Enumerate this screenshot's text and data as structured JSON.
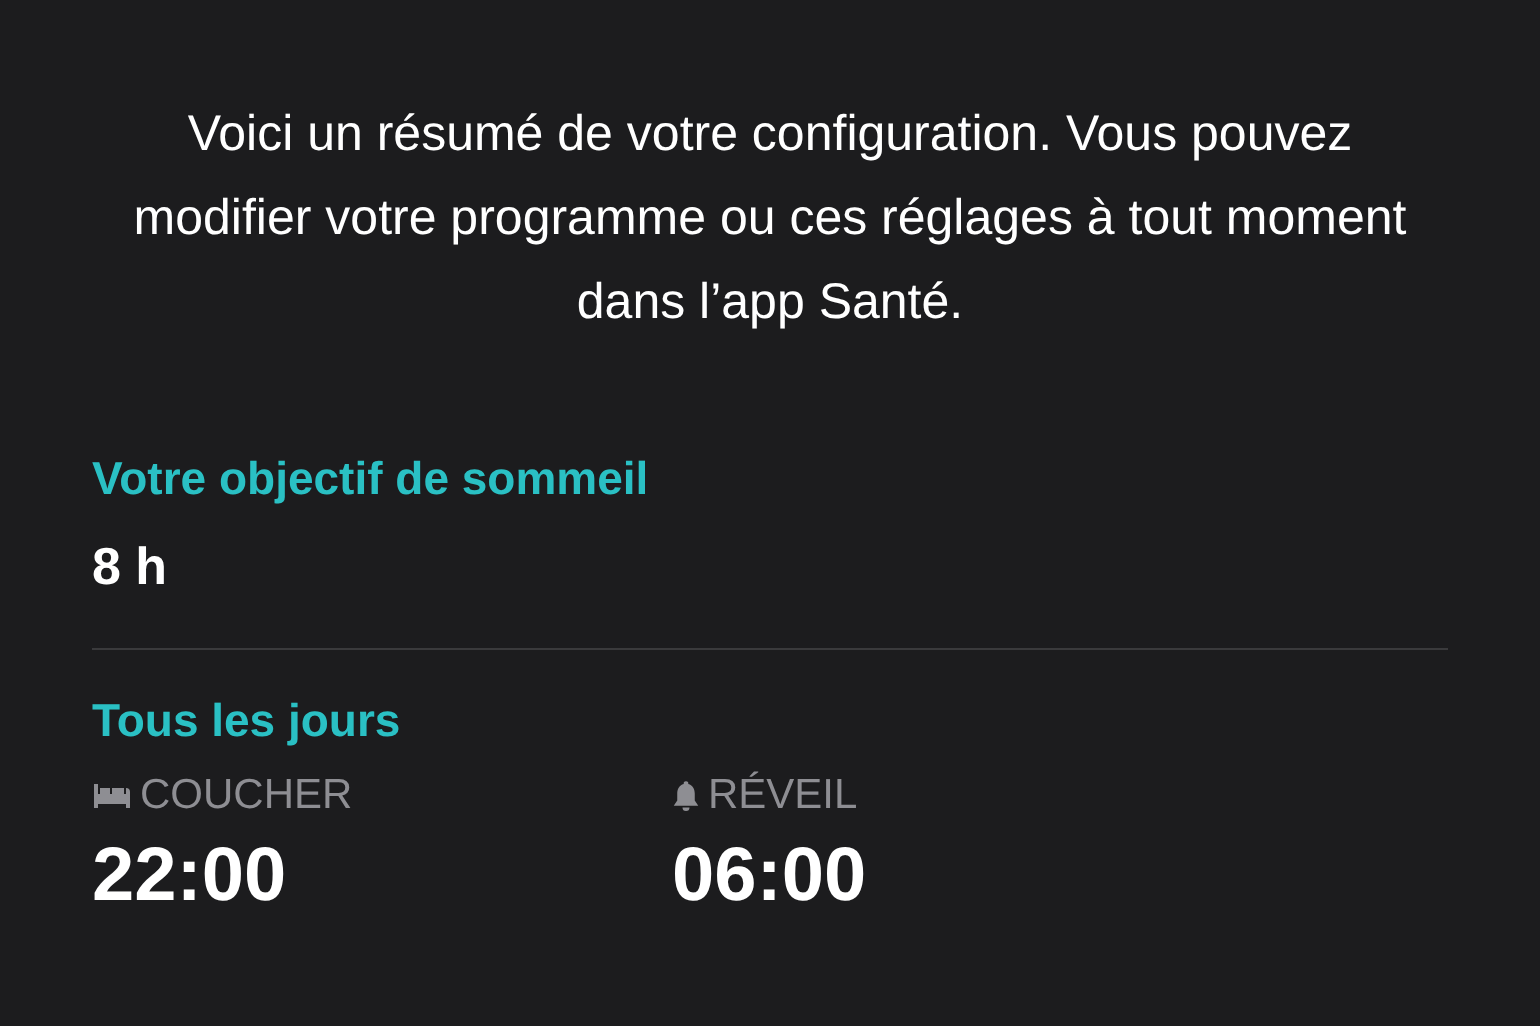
{
  "description": "Voici un résumé de votre configuration. Vous pouvez modifier votre programme ou ces réglages à tout moment dans l’app Santé.",
  "sections": [
    {
      "heading": "Votre objectif de sommeil",
      "value": "8 h"
    },
    {
      "heading": "Tous les jours",
      "times": [
        {
          "kind": "bed",
          "label": "COUCHER",
          "time": "22:00"
        },
        {
          "kind": "alarm",
          "label": "RÉVEIL",
          "time": "06:00"
        }
      ]
    }
  ]
}
